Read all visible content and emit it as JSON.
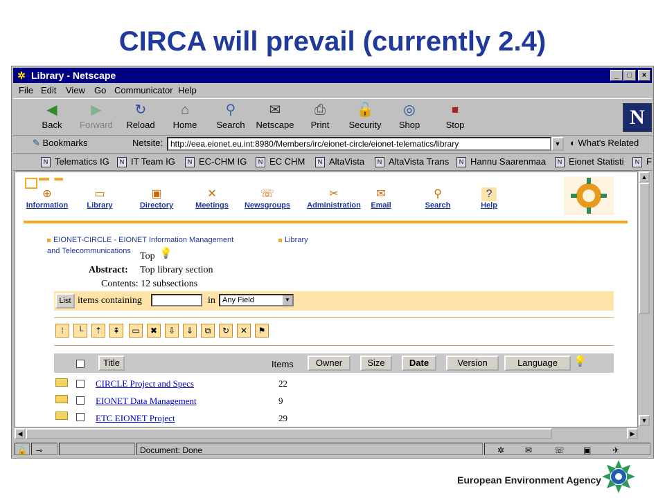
{
  "slide": {
    "title": "CIRCA will prevail (currently 2.4)"
  },
  "window": {
    "title": "Library - Netscape",
    "minimize": "_",
    "maximize": "□",
    "close": "×"
  },
  "menu": [
    "File",
    "Edit",
    "View",
    "Go",
    "Communicator",
    "Help"
  ],
  "toolbar": {
    "back": "Back",
    "forward": "Forward",
    "reload": "Reload",
    "home": "Home",
    "search": "Search",
    "netscape": "Netscape",
    "print": "Print",
    "security": "Security",
    "shop": "Shop",
    "stop": "Stop",
    "logo": "N"
  },
  "location": {
    "bookmarks": "Bookmarks",
    "netsite_label": "Netsite:",
    "url": "http://eea.eionet.eu.int:8980/Members/irc/eionet-circle/eionet-telematics/library",
    "whats_related": "What's Related"
  },
  "personal": [
    "Telematics IG",
    "IT Team IG",
    "EC-CHM IG",
    "EC CHM",
    "AltaVista",
    "AltaVista Trans",
    "Hannu Saarenmaa",
    "Eionet Statisti",
    "F"
  ],
  "circa_nav": {
    "information": "Information",
    "library": "Library",
    "directory": "Directory",
    "meetings": "Meetings",
    "newsgroups": "Newsgroups",
    "administration": "Administration",
    "email": "Email",
    "search": "Search",
    "help": "Help"
  },
  "breadcrumb": {
    "group": "EIONET-CIRCLE - EIONET Information Management",
    "group2": "and Telecommunications",
    "section": "Library"
  },
  "library": {
    "top": "Top",
    "abstract_label": "Abstract:",
    "abstract_value": "Top library section",
    "contents": "Contents: 12 subsections",
    "list_button": "List",
    "items_containing": "items containing",
    "in_label": "in",
    "field_select": "Any Field"
  },
  "table": {
    "headers": {
      "title": "Title",
      "items": "Items",
      "owner": "Owner",
      "size": "Size",
      "date": "Date",
      "version": "Version",
      "language": "Language"
    },
    "rows": [
      {
        "title": "CIRCLE Project and Specs",
        "items": "22"
      },
      {
        "title": "EIONET Data Management",
        "items": "9"
      },
      {
        "title": "ETC EIONET Project",
        "items": "29"
      }
    ]
  },
  "status": {
    "text": "Document: Done"
  },
  "footer": {
    "agency": "European Environment Agency"
  },
  "colors": {
    "title_blue": "#1f3a9a",
    "circa_orange": "#f5a623",
    "titlebar": "#000080"
  }
}
